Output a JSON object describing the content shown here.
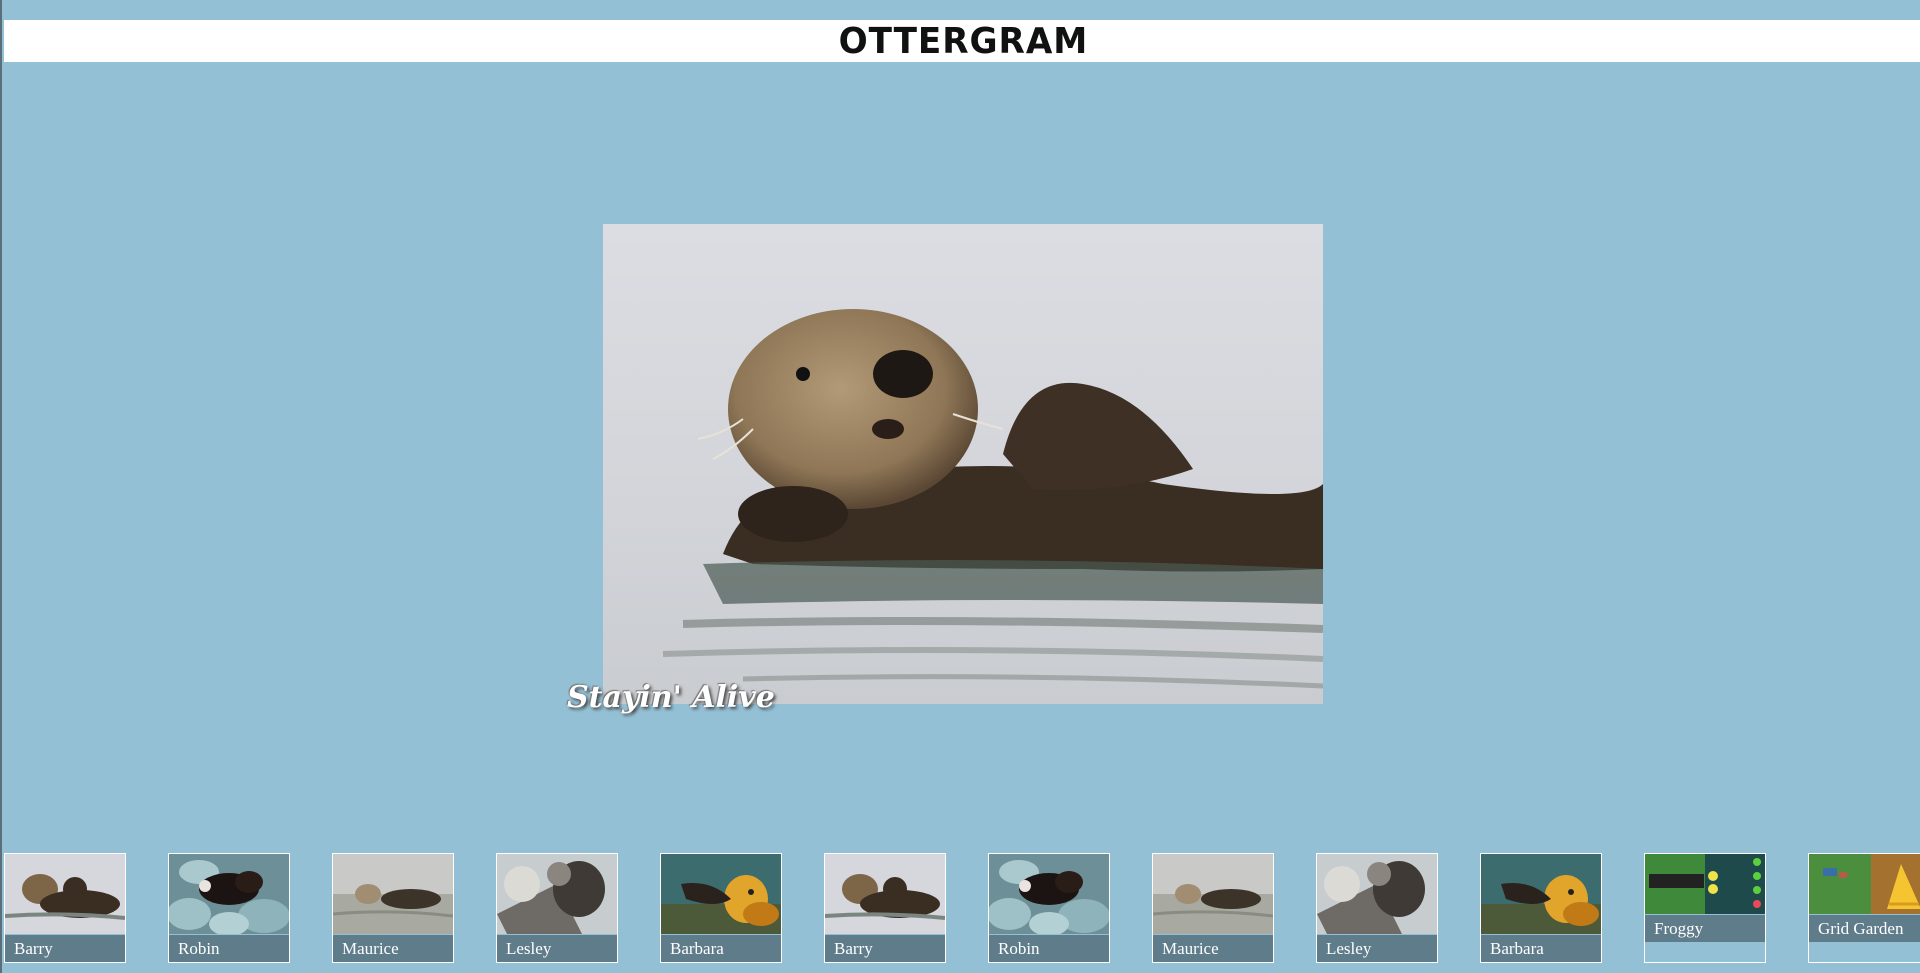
{
  "header": {
    "logo": "OTTERGRAM"
  },
  "detail": {
    "title": "Stayin' Alive",
    "image": "otter-floating-photo"
  },
  "thumbnails": [
    {
      "label": "Barry",
      "image": "otter-floating"
    },
    {
      "label": "Robin",
      "image": "otter-on-rocks"
    },
    {
      "label": "Maurice",
      "image": "otter-in-water"
    },
    {
      "label": "Lesley",
      "image": "otters-on-log"
    },
    {
      "label": "Barbara",
      "image": "otter-orange"
    },
    {
      "label": "Barry",
      "image": "otter-floating"
    },
    {
      "label": "Robin",
      "image": "otter-on-rocks"
    },
    {
      "label": "Maurice",
      "image": "otter-in-water"
    },
    {
      "label": "Lesley",
      "image": "otters-on-log"
    },
    {
      "label": "Barbara",
      "image": "otter-orange"
    },
    {
      "label": "Froggy",
      "image": "froggy-game-screenshot"
    },
    {
      "label": "Grid Garden",
      "image": "grid-garden-game-screenshot"
    }
  ],
  "colors": {
    "background": "#94c0d6",
    "label_background": "#5f7c8b",
    "header_background": "#ffffff"
  }
}
